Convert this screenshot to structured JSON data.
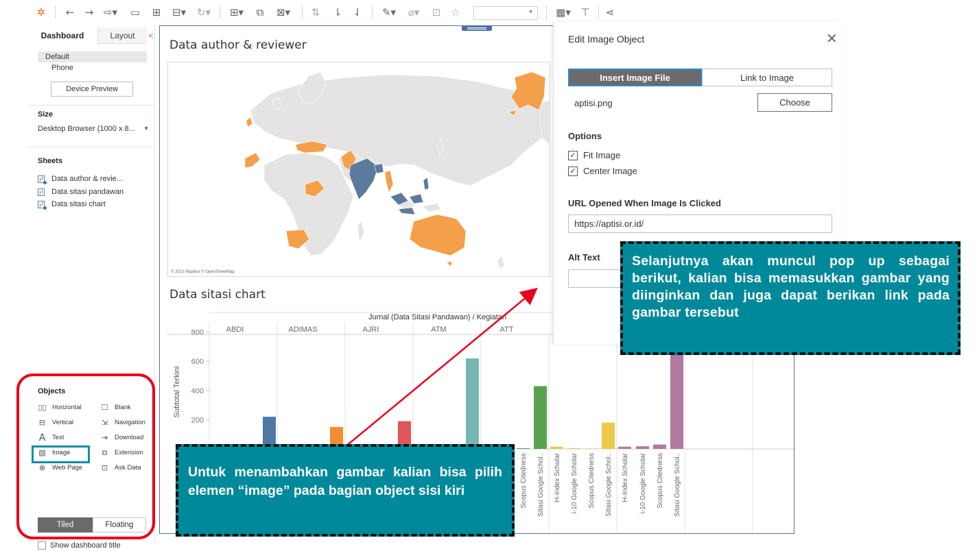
{
  "toolbar": {
    "icons": [
      "tableau-logo-icon",
      "undo-icon",
      "redo-icon",
      "replay-icon",
      "save-icon",
      "add-datasource-icon",
      "pause-update-icon",
      "refresh-icon",
      "new-worksheet-icon",
      "duplicate-icon",
      "clear-icon",
      "swap-icon",
      "sort-asc-icon",
      "sort-desc-icon",
      "highlight-icon",
      "group-icon",
      "labels-icon",
      "pin-icon",
      "fit-select",
      "show-cards-icon",
      "presentation-icon",
      "share-icon"
    ]
  },
  "left_panel": {
    "tabs": {
      "dashboard": "Dashboard",
      "layout": "Layout",
      "collapse": "<"
    },
    "device": {
      "default": "Default",
      "phone": "Phone",
      "preview_button": "Device Preview"
    },
    "size": {
      "heading": "Size",
      "value": "Desktop Browser (1000 x 8..."
    },
    "sheets": {
      "heading": "Sheets",
      "items": [
        {
          "label": "Data author & revie...",
          "used": true
        },
        {
          "label": "Data sitasi pandawan",
          "used": false
        },
        {
          "label": "Data sitasi chart",
          "used": true
        }
      ]
    },
    "objects": {
      "heading": "Objects",
      "items": [
        {
          "label": "Horizontal",
          "icon": "horizontal-icon"
        },
        {
          "label": "Blank",
          "icon": "blank-icon"
        },
        {
          "label": "Vertical",
          "icon": "vertical-icon"
        },
        {
          "label": "Navigation",
          "icon": "navigation-icon"
        },
        {
          "label": "Text",
          "icon": "text-icon"
        },
        {
          "label": "Download",
          "icon": "download-icon"
        },
        {
          "label": "Image",
          "icon": "image-icon"
        },
        {
          "label": "Extension",
          "icon": "extension-icon"
        },
        {
          "label": "Web Page",
          "icon": "web-page-icon"
        },
        {
          "label": "Ask Data",
          "icon": "ask-data-icon"
        }
      ]
    },
    "layout_mode": {
      "tiled": "Tiled",
      "floating": "Floating",
      "active": "Tiled"
    },
    "show_title": {
      "label": "Show dashboard title",
      "checked": false
    }
  },
  "dashboard": {
    "map_title": "Data author & reviewer",
    "map_attribution": "© 2022 Mapbox © OpenStreetMap",
    "chart_title": "Data sitasi chart"
  },
  "chart_data": {
    "type": "bar",
    "title": "",
    "header_label": "Jurnal (Data Sitasi Pandawan) / Kegiatan",
    "ylabel": "Subtotal Terkini",
    "ylim": [
      0,
      850
    ],
    "yticks": [
      200,
      400,
      600,
      800
    ],
    "panels": [
      "ABDI",
      "ADIMAS",
      "AJRI",
      "ATM",
      "ATT"
    ],
    "bars": [
      {
        "panel": "ABDI",
        "value": 220,
        "color": "#4e79a7"
      },
      {
        "panel": "ADIMAS",
        "value": 150,
        "color": "#f28e2b"
      },
      {
        "panel": "AJRI",
        "value": 190,
        "color": "#e15759"
      },
      {
        "panel": "ATM",
        "value": 620,
        "color": "#76b7b2"
      },
      {
        "panel": "ATT",
        "category": "Scopus Citedness",
        "value": 5,
        "color": "#59a14f"
      },
      {
        "panel": "ATT",
        "category": "Sitasi Google Schol..",
        "value": 430,
        "color": "#59a14f"
      },
      {
        "category": "H-Index Scholar",
        "value": 15,
        "color": "#edc948"
      },
      {
        "category": "i-10 Google Scholar",
        "value": 5,
        "color": "#edc948"
      },
      {
        "category": "Scopus Citedness",
        "value": 3,
        "color": "#edc948"
      },
      {
        "category": "Sitasi Google Schol..",
        "value": 180,
        "color": "#edc948"
      },
      {
        "category": "H-Index Scholar",
        "value": 15,
        "color": "#b07aa1"
      },
      {
        "category": "i-10 Google Scholar",
        "value": 18,
        "color": "#b07aa1"
      },
      {
        "category": "Scopus Citedness",
        "value": 30,
        "color": "#b07aa1"
      },
      {
        "category": "Sitasi Google Schol..",
        "value": 820,
        "color": "#b07aa1"
      }
    ]
  },
  "dialog": {
    "title": "Edit Image Object",
    "tab_insert": "Insert Image File",
    "tab_link": "Link to Image",
    "file_name": "aptisi.png",
    "choose_button": "Choose",
    "options_label": "Options",
    "fit_image": {
      "label": "Fit Image",
      "checked": true
    },
    "center_image": {
      "label": "Center Image",
      "checked": true
    },
    "url_label": "URL Opened When Image Is Clicked",
    "url_value": "https://aptisi.or.id/",
    "alt_text_label": "Alt Text",
    "alt_text_value": ""
  },
  "annotations": {
    "right_text": "Selanjutnya akan muncul pop up sebagai berikut, kalian bisa memasukkan gambar yang diinginkan dan juga dapat berikan link pada gambar tersebut",
    "left_text": "Untuk menambahkan gambar kalian bisa pilih elemen “image” pada bagian object sisi kiri",
    "callout_color": "#00899a",
    "arrow_color": "#e8001c",
    "highlight_color": "#e8001c"
  },
  "map_colors": {
    "orange": "#f4a04a",
    "blue": "#5c7a9b",
    "land": "#e4e4e4"
  }
}
